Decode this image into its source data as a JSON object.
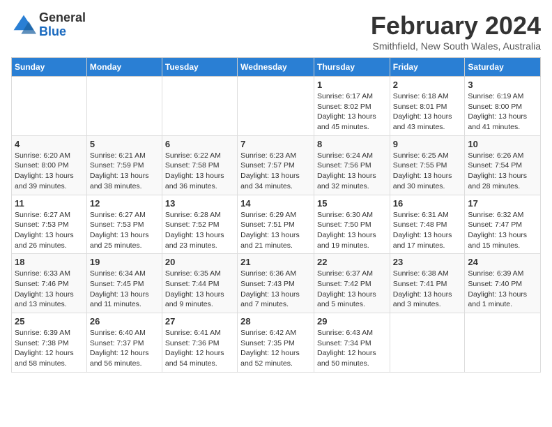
{
  "header": {
    "logo": {
      "general": "General",
      "blue": "Blue"
    },
    "title": "February 2024",
    "location": "Smithfield, New South Wales, Australia"
  },
  "calendar": {
    "days_of_week": [
      "Sunday",
      "Monday",
      "Tuesday",
      "Wednesday",
      "Thursday",
      "Friday",
      "Saturday"
    ],
    "weeks": [
      [
        {
          "day": "",
          "info": ""
        },
        {
          "day": "",
          "info": ""
        },
        {
          "day": "",
          "info": ""
        },
        {
          "day": "",
          "info": ""
        },
        {
          "day": "1",
          "info": "Sunrise: 6:17 AM\nSunset: 8:02 PM\nDaylight: 13 hours\nand 45 minutes."
        },
        {
          "day": "2",
          "info": "Sunrise: 6:18 AM\nSunset: 8:01 PM\nDaylight: 13 hours\nand 43 minutes."
        },
        {
          "day": "3",
          "info": "Sunrise: 6:19 AM\nSunset: 8:00 PM\nDaylight: 13 hours\nand 41 minutes."
        }
      ],
      [
        {
          "day": "4",
          "info": "Sunrise: 6:20 AM\nSunset: 8:00 PM\nDaylight: 13 hours\nand 39 minutes."
        },
        {
          "day": "5",
          "info": "Sunrise: 6:21 AM\nSunset: 7:59 PM\nDaylight: 13 hours\nand 38 minutes."
        },
        {
          "day": "6",
          "info": "Sunrise: 6:22 AM\nSunset: 7:58 PM\nDaylight: 13 hours\nand 36 minutes."
        },
        {
          "day": "7",
          "info": "Sunrise: 6:23 AM\nSunset: 7:57 PM\nDaylight: 13 hours\nand 34 minutes."
        },
        {
          "day": "8",
          "info": "Sunrise: 6:24 AM\nSunset: 7:56 PM\nDaylight: 13 hours\nand 32 minutes."
        },
        {
          "day": "9",
          "info": "Sunrise: 6:25 AM\nSunset: 7:55 PM\nDaylight: 13 hours\nand 30 minutes."
        },
        {
          "day": "10",
          "info": "Sunrise: 6:26 AM\nSunset: 7:54 PM\nDaylight: 13 hours\nand 28 minutes."
        }
      ],
      [
        {
          "day": "11",
          "info": "Sunrise: 6:27 AM\nSunset: 7:53 PM\nDaylight: 13 hours\nand 26 minutes."
        },
        {
          "day": "12",
          "info": "Sunrise: 6:27 AM\nSunset: 7:53 PM\nDaylight: 13 hours\nand 25 minutes."
        },
        {
          "day": "13",
          "info": "Sunrise: 6:28 AM\nSunset: 7:52 PM\nDaylight: 13 hours\nand 23 minutes."
        },
        {
          "day": "14",
          "info": "Sunrise: 6:29 AM\nSunset: 7:51 PM\nDaylight: 13 hours\nand 21 minutes."
        },
        {
          "day": "15",
          "info": "Sunrise: 6:30 AM\nSunset: 7:50 PM\nDaylight: 13 hours\nand 19 minutes."
        },
        {
          "day": "16",
          "info": "Sunrise: 6:31 AM\nSunset: 7:48 PM\nDaylight: 13 hours\nand 17 minutes."
        },
        {
          "day": "17",
          "info": "Sunrise: 6:32 AM\nSunset: 7:47 PM\nDaylight: 13 hours\nand 15 minutes."
        }
      ],
      [
        {
          "day": "18",
          "info": "Sunrise: 6:33 AM\nSunset: 7:46 PM\nDaylight: 13 hours\nand 13 minutes."
        },
        {
          "day": "19",
          "info": "Sunrise: 6:34 AM\nSunset: 7:45 PM\nDaylight: 13 hours\nand 11 minutes."
        },
        {
          "day": "20",
          "info": "Sunrise: 6:35 AM\nSunset: 7:44 PM\nDaylight: 13 hours\nand 9 minutes."
        },
        {
          "day": "21",
          "info": "Sunrise: 6:36 AM\nSunset: 7:43 PM\nDaylight: 13 hours\nand 7 minutes."
        },
        {
          "day": "22",
          "info": "Sunrise: 6:37 AM\nSunset: 7:42 PM\nDaylight: 13 hours\nand 5 minutes."
        },
        {
          "day": "23",
          "info": "Sunrise: 6:38 AM\nSunset: 7:41 PM\nDaylight: 13 hours\nand 3 minutes."
        },
        {
          "day": "24",
          "info": "Sunrise: 6:39 AM\nSunset: 7:40 PM\nDaylight: 13 hours\nand 1 minute."
        }
      ],
      [
        {
          "day": "25",
          "info": "Sunrise: 6:39 AM\nSunset: 7:38 PM\nDaylight: 12 hours\nand 58 minutes."
        },
        {
          "day": "26",
          "info": "Sunrise: 6:40 AM\nSunset: 7:37 PM\nDaylight: 12 hours\nand 56 minutes."
        },
        {
          "day": "27",
          "info": "Sunrise: 6:41 AM\nSunset: 7:36 PM\nDaylight: 12 hours\nand 54 minutes."
        },
        {
          "day": "28",
          "info": "Sunrise: 6:42 AM\nSunset: 7:35 PM\nDaylight: 12 hours\nand 52 minutes."
        },
        {
          "day": "29",
          "info": "Sunrise: 6:43 AM\nSunset: 7:34 PM\nDaylight: 12 hours\nand 50 minutes."
        },
        {
          "day": "",
          "info": ""
        },
        {
          "day": "",
          "info": ""
        }
      ]
    ]
  }
}
